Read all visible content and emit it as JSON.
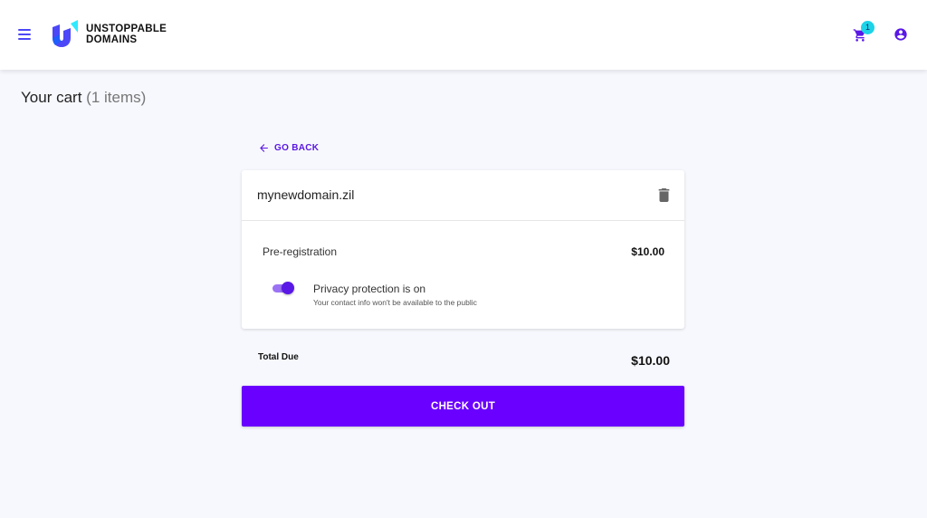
{
  "header": {
    "logo_line1": "UNSTOPPABLE",
    "logo_line2": "DOMAINS",
    "cart_count": "1",
    "icons": {
      "menu": "menu-icon",
      "logo": "unstoppable-domains-logo-icon",
      "cart": "cart-icon",
      "account": "account-circle-icon"
    },
    "accent_color": "#4c47f7",
    "badge_color": "#1dd3e8"
  },
  "page": {
    "title": "Your cart",
    "item_count": "(1 items)"
  },
  "nav": {
    "go_back": "GO BACK"
  },
  "cart_item": {
    "domain": "mynewdomain.zil",
    "line_label": "Pre-registration",
    "line_price": "$10.00",
    "privacy": {
      "enabled": true,
      "title": "Privacy protection is on",
      "subtitle": "Your contact info won't be available to the public"
    }
  },
  "summary": {
    "total_label": "Total Due",
    "total_value": "$10.00"
  },
  "actions": {
    "checkout_label": "CHECK OUT",
    "checkout_color": "#6a00ff"
  }
}
